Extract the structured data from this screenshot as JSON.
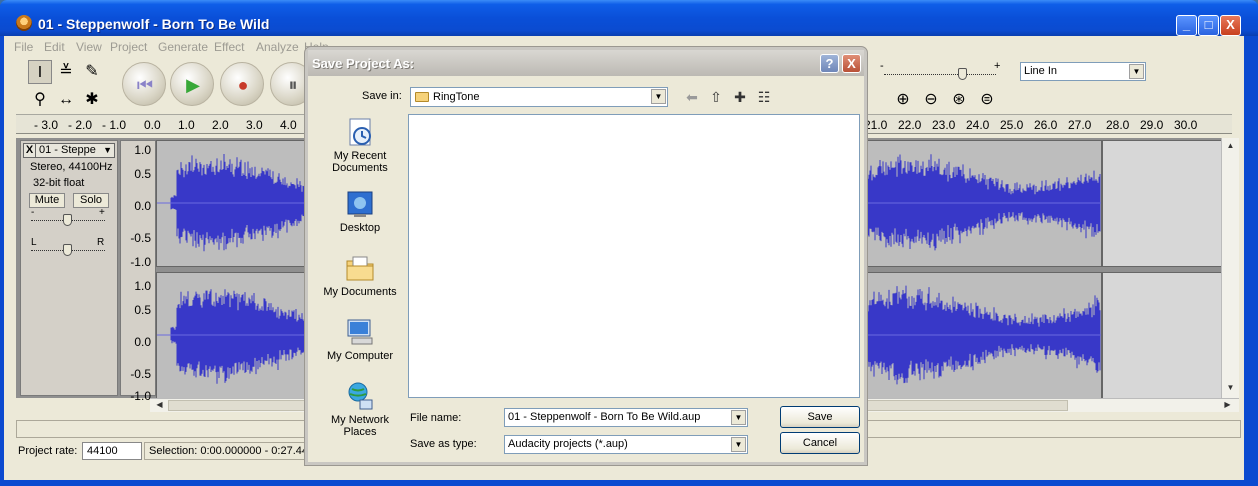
{
  "window": {
    "title": "01 - Steppenwolf - Born To Be Wild",
    "min": "_",
    "max": "□",
    "close": "X"
  },
  "menu": [
    "File",
    "Edit",
    "View",
    "Project",
    "Generate",
    "Effect",
    "Analyze",
    "Help"
  ],
  "meter": {
    "minus": "-",
    "plus": "+"
  },
  "input_source": "Line In",
  "ruler": [
    "- 3.0",
    "- 2.0",
    "- 1.0",
    "0.0",
    "1.0",
    "2.0",
    "3.0",
    "4.0",
    "21.0",
    "22.0",
    "23.0",
    "24.0",
    "25.0",
    "26.0",
    "27.0",
    "28.0",
    "29.0",
    "30.0"
  ],
  "track": {
    "close": "X",
    "name": "01 - Steppe",
    "format": "Stereo, 44100Hz",
    "depth": "32-bit float",
    "mute": "Mute",
    "solo": "Solo",
    "gain_minus": "-",
    "gain_plus": "+",
    "pan_left": "L",
    "pan_right": "R"
  },
  "vruler_top": [
    "1.0",
    "0.5",
    "0.0",
    "-0.5",
    "-1.0"
  ],
  "vruler_bottom": [
    "1.0",
    "0.5",
    "0.0",
    "-0.5",
    "-1.0"
  ],
  "status": {
    "project_rate_label": "Project rate:",
    "project_rate": "44100",
    "selection": "Selection: 0:00.000000 - 0:27.443"
  },
  "dialog": {
    "title": "Save Project As:",
    "help": "?",
    "close": "X",
    "save_in_label": "Save in:",
    "save_in_value": "RingTone",
    "places": [
      {
        "label": "My Recent Documents"
      },
      {
        "label": "Desktop"
      },
      {
        "label": "My Documents"
      },
      {
        "label": "My Computer"
      },
      {
        "label": "My Network Places"
      }
    ],
    "file_name_label": "File name:",
    "file_name_value": "01 - Steppenwolf - Born To Be Wild.aup",
    "save_type_label": "Save as type:",
    "save_type_value": "Audacity projects (*.aup)",
    "save_button": "Save",
    "cancel_button": "Cancel"
  },
  "colors": {
    "wave": "#3838c8",
    "wave_bg": "#bdbdbd",
    "titlebar": "#0a4fd8"
  }
}
